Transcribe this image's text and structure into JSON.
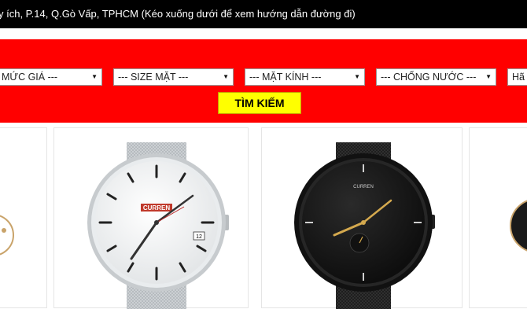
{
  "topbar": {
    "address_text": "y ích, P.14, Q.Gò Vấp, TPHCM (Kéo xuống dưới để xem hướng dẫn đường đi)"
  },
  "filters": {
    "price": "MỨC GIÁ ---",
    "face_size": "--- SIZE MẶT ---",
    "glass": "--- MẶT KÍNH ---",
    "water_resistance": "--- CHỐNG NƯỚC ---",
    "brand": "Hã",
    "search_label": "TÌM KIẾM"
  },
  "products": [
    {
      "brand_mark": ""
    },
    {
      "brand_mark": "CURREN",
      "date_window": "12"
    },
    {
      "brand_mark": "CURREN"
    },
    {
      "brand_mark": ""
    }
  ],
  "colors": {
    "filter_bg": "#ff0000",
    "search_button": "#ffff00",
    "topbar_bg": "#000000"
  }
}
